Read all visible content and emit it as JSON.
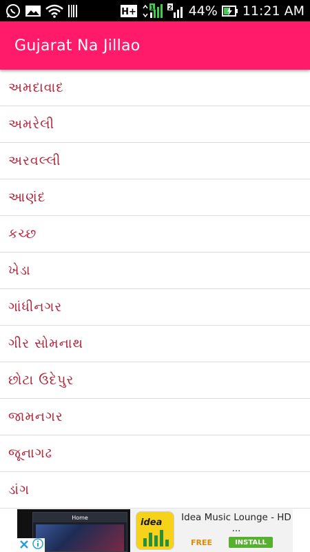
{
  "status_bar": {
    "left_icons": [
      "whatsapp-icon",
      "gallery-icon",
      "wifi-icon",
      "barcode-icon"
    ],
    "network_type": "H+",
    "sim1": "1",
    "sim2": "2",
    "battery_percent": "44%",
    "time": "11:21 AM"
  },
  "app_bar": {
    "title": "Gujarat Na Jillao",
    "background_color": "#ff1a6a"
  },
  "districts": [
    {
      "label": "અમદાવાદ"
    },
    {
      "label": "અમરેલી"
    },
    {
      "label": "અરવલ્લી"
    },
    {
      "label": "આણંદ"
    },
    {
      "label": "કચ્છ"
    },
    {
      "label": "ખેડા"
    },
    {
      "label": "ગાંધીનગર"
    },
    {
      "label": "ગીર સોમનાથ"
    },
    {
      "label": "છોટા ઉદેપુર"
    },
    {
      "label": "જામનગર"
    },
    {
      "label": "જૂનાગઢ"
    },
    {
      "label": "ડાંગ"
    }
  ],
  "ad": {
    "screenshot_header": "Home",
    "app_icon_text": "idea",
    "title": "Idea Music Lounge - HD ...",
    "price": "FREE",
    "install_label": "INSTALL",
    "install_color": "#58b030"
  },
  "colors": {
    "list_text": "#b3263a",
    "divider": "#dcdcdc",
    "status_bar": "#000000"
  }
}
